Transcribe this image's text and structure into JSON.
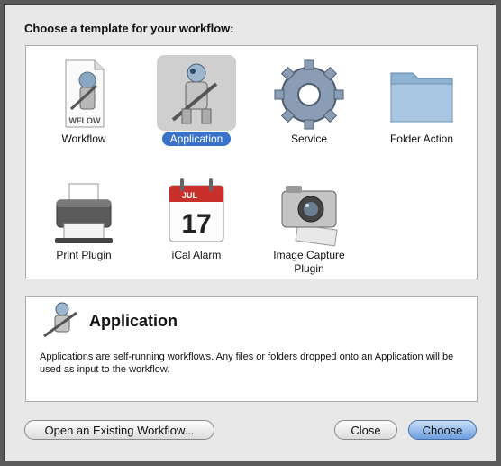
{
  "dialog": {
    "heading": "Choose a template for your workflow:"
  },
  "templates": [
    {
      "label": "Workflow",
      "icon": "workflow-file-icon",
      "badge": "WFLOW"
    },
    {
      "label": "Application",
      "icon": "automator-robot-icon",
      "selected": true
    },
    {
      "label": "Service",
      "icon": "gear-icon"
    },
    {
      "label": "Folder Action",
      "icon": "folder-icon"
    },
    {
      "label": "Print Plugin",
      "icon": "printer-icon"
    },
    {
      "label": "iCal Alarm",
      "icon": "calendar-icon",
      "month": "JUL",
      "day": "17"
    },
    {
      "label": "Image Capture Plugin",
      "icon": "camera-icon"
    }
  ],
  "description": {
    "title": "Application",
    "text": "Applications are self-running workflows. Any files or folders dropped onto an Application will be used as input to the workflow."
  },
  "buttons": {
    "open_existing": "Open an Existing Workflow...",
    "close": "Close",
    "choose": "Choose"
  }
}
